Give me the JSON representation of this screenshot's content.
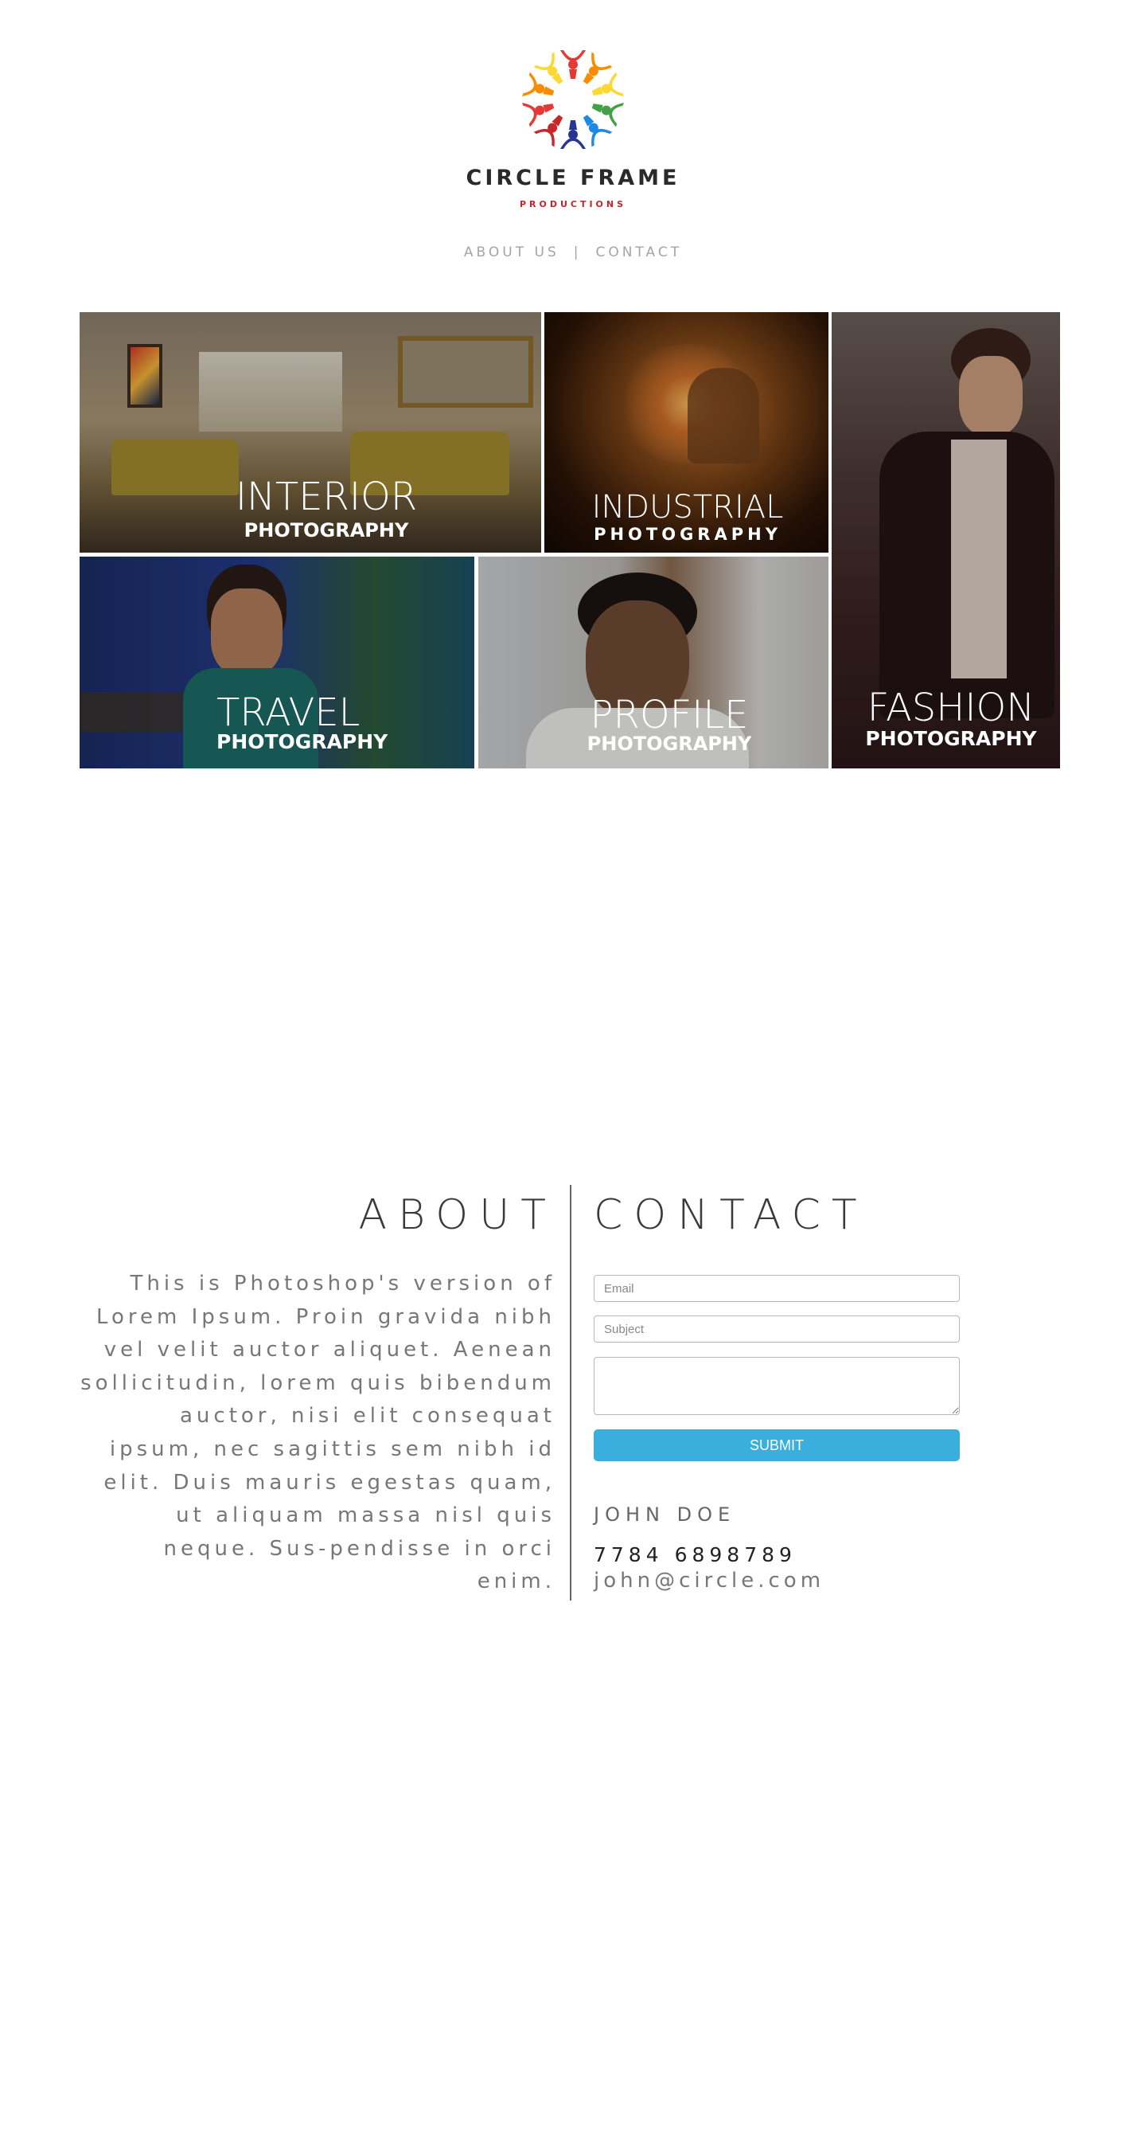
{
  "brand": {
    "name": "CIRCLE FRAME",
    "tagline": "PRODUCTIONS",
    "logo_icon": "people-circle-logo",
    "logo_colors": [
      "#e53935",
      "#fb8c00",
      "#fdd835",
      "#43a047",
      "#1e88e5",
      "#283593",
      "#c62828"
    ]
  },
  "nav": {
    "about": "ABOUT US",
    "separator": "|",
    "contact": "CONTACT"
  },
  "gallery": [
    {
      "id": "interior",
      "title": "INTERIOR",
      "subtitle": "PHOTOGRAPHY"
    },
    {
      "id": "industrial",
      "title": "INDUSTRIAL",
      "subtitle": "PHOTOGRAPHY"
    },
    {
      "id": "fashion",
      "title": "FASHION",
      "subtitle": "PHOTOGRAPHY"
    },
    {
      "id": "travel",
      "title": "TRAVEL",
      "subtitle": "PHOTOGRAPHY"
    },
    {
      "id": "profile",
      "title": "PROFILE",
      "subtitle": "PHOTOGRAPHY"
    }
  ],
  "about": {
    "title": "ABOUT",
    "body": "This is Photoshop's version of Lorem Ipsum. Proin gravida nibh vel velit auctor aliquet. Aenean sollicitudin, lorem quis bibendum auctor, nisi elit consequat ipsum, nec sagittis sem nibh id elit. Duis mauris egestas quam, ut aliquam massa nisl quis neque. Sus-pendisse in orci enim."
  },
  "contact": {
    "title": "CONTACT",
    "email_placeholder": "Email",
    "subject_placeholder": "Subject",
    "message_placeholder": "",
    "submit_label": "SUBMIT",
    "submit_color": "#3aaedc",
    "person": {
      "name": "JOHN DOE",
      "phone": "7784 6898789",
      "email": "john@circle.com"
    }
  }
}
